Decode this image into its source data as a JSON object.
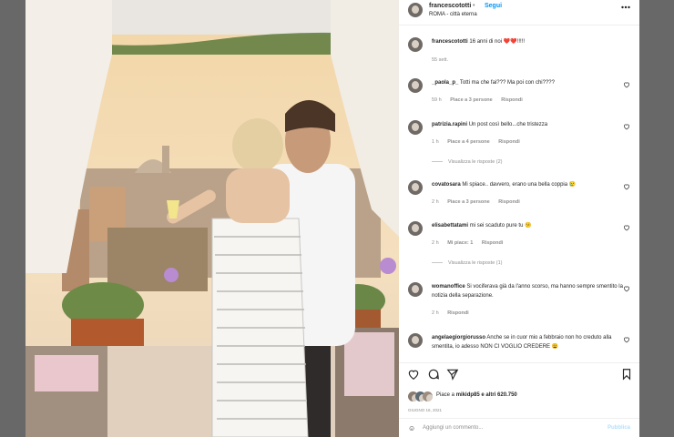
{
  "header": {
    "username": "francescototti",
    "dot": "•",
    "follow_label": "Segui",
    "location": "ROMA - città eterna",
    "more_icon": "more-icon"
  },
  "caption": {
    "username": "francescototti",
    "text": "16 anni di noi ❤️❤️!!!!!",
    "time": "55 sett."
  },
  "comments": [
    {
      "username": "_paola_p_",
      "text": "Totti ma che fai??? Ma poi con chi????",
      "time": "59 h",
      "likes": "Piace a 3 persone",
      "reply": "Rispondi",
      "view_replies": ""
    },
    {
      "username": "patrizia.rapini",
      "text": "Un post così bello...che tristezza",
      "time": "1 h",
      "likes": "Piace a 4 persone",
      "reply": "Rispondi",
      "view_replies": "Visualizza le risposte (2)"
    },
    {
      "username": "covatosara",
      "text": "Mi spiace.. davvero, erano una bella coppia 😢",
      "time": "2 h",
      "likes": "Piace a 3 persone",
      "reply": "Rispondi",
      "view_replies": ""
    },
    {
      "username": "elisabettatami",
      "text": "mi sei scaduto pure tu 😕",
      "time": "2 h",
      "likes": "Mi piace: 1",
      "reply": "Rispondi",
      "view_replies": "Visualizza le risposte (1)"
    },
    {
      "username": "womanoffice",
      "text": "Si vociferava già da l'anno scorso, ma hanno sempre smentito la notizia della separazione.",
      "time": "2 h",
      "likes": "",
      "reply": "Rispondi",
      "view_replies": ""
    },
    {
      "username": "angelaegiorgiorusso",
      "text": "Anche se in cuor mio a febbraio non ho creduto alla smentita, io adesso NON CI VOGLIO CREDERE 😩",
      "time": "",
      "likes": "",
      "reply": "",
      "view_replies": ""
    }
  ],
  "actions": {
    "liked_by": "Piace a",
    "liked_user": "mikidp85",
    "liked_rest": "e altri 620.750",
    "date": "GIUGNO 16, 2021",
    "add_comment_placeholder": "Aggiungi un commento...",
    "publish_label": "Pubblica"
  },
  "colors": {
    "accent": "#0095f6",
    "heart_red": "#ed4956",
    "text": "#262626",
    "muted": "#8e8e8e"
  }
}
